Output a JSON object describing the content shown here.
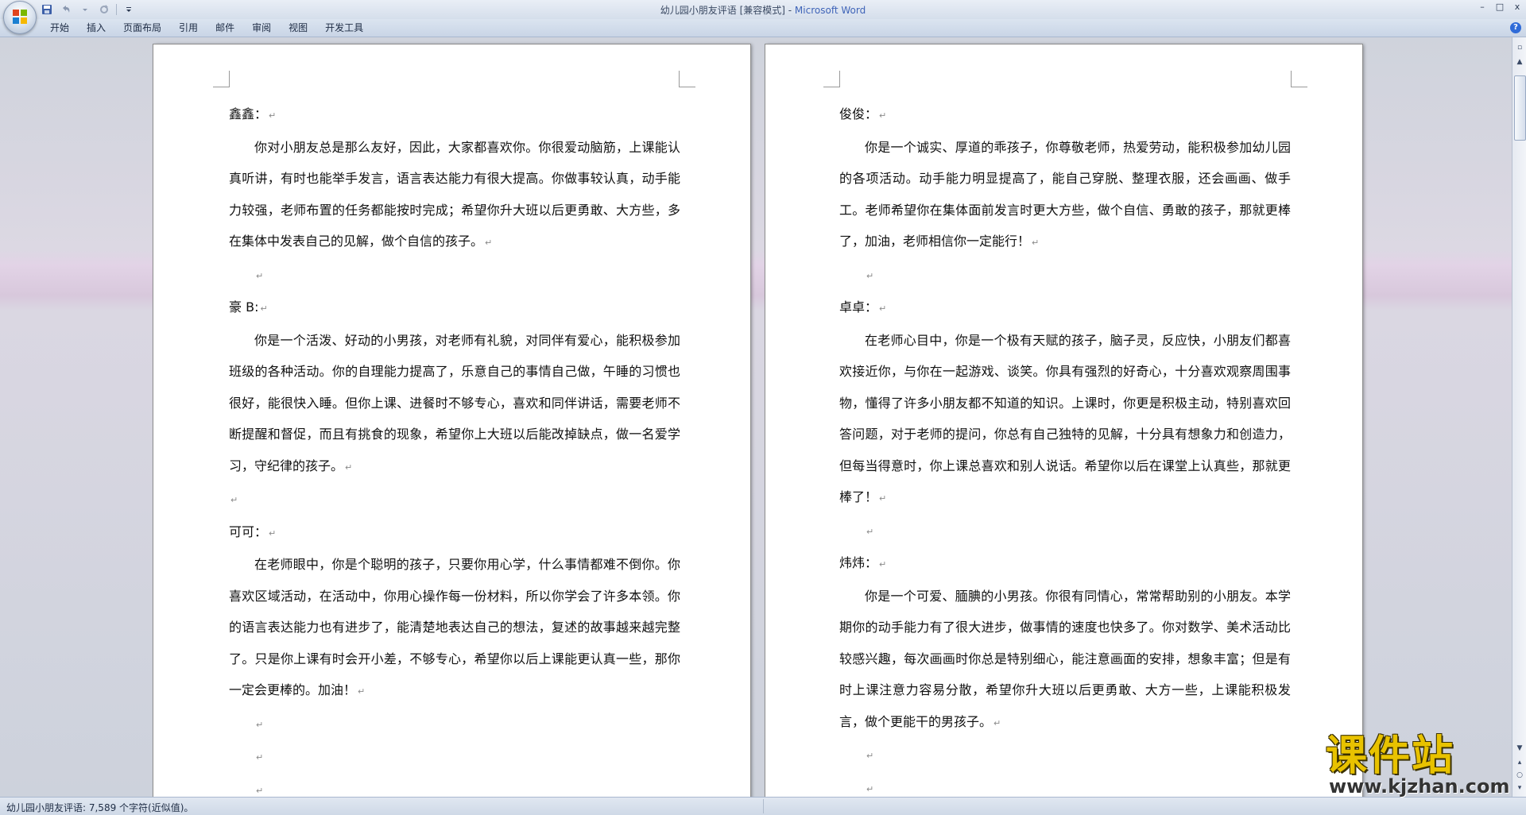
{
  "window": {
    "title_doc": "幼儿园小朋友评语 [兼容模式] - ",
    "title_app": "Microsoft Word",
    "minimize": "–",
    "maximize": "□",
    "close": "x"
  },
  "ribbon": {
    "tabs": [
      "开始",
      "插入",
      "页面布局",
      "引用",
      "邮件",
      "审阅",
      "视图",
      "开发工具"
    ],
    "help": "?"
  },
  "pages": {
    "left": [
      {
        "type": "heading",
        "text": "鑫鑫："
      },
      {
        "type": "body",
        "text": "你对小朋友总是那么友好，因此，大家都喜欢你。你很爱动脑筋，上课能认真听讲，有时也能举手发言，语言表达能力有很大提高。你做事较认真，动手能力较强，老师布置的任务都能按时完成；希望你升大班以后更勇敢、大方些，多在集体中发表自己的见解，做个自信的孩子。"
      },
      {
        "type": "empty",
        "text": ""
      },
      {
        "type": "heading",
        "text": "豪 B:"
      },
      {
        "type": "body",
        "text": "你是一个活泼、好动的小男孩，对老师有礼貌，对同伴有爱心，能积极参加班级的各种活动。你的自理能力提高了，乐意自己的事情自己做，午睡的习惯也很好，能很快入睡。但你上课、进餐时不够专心，喜欢和同伴讲话，需要老师不断提醒和督促，而且有挑食的现象，希望你上大班以后能改掉缺点，做一名爱学习，守纪律的孩子。"
      },
      {
        "type": "empty-flush",
        "text": ""
      },
      {
        "type": "heading",
        "text": "可可："
      },
      {
        "type": "body",
        "text": "在老师眼中，你是个聪明的孩子，只要你用心学，什么事情都难不倒你。你喜欢区域活动，在活动中，你用心操作每一份材料，所以你学会了许多本领。你的语言表达能力也有进步了，能清楚地表达自己的想法，复述的故事越来越完整了。只是你上课有时会开小差，不够专心，希望你以后上课能更认真一些，那你一定会更棒的。加油！"
      },
      {
        "type": "empty",
        "text": ""
      },
      {
        "type": "empty",
        "text": ""
      },
      {
        "type": "empty",
        "text": ""
      }
    ],
    "right": [
      {
        "type": "heading",
        "text": "俊俊："
      },
      {
        "type": "body",
        "text": "你是一个诚实、厚道的乖孩子，你尊敬老师，热爱劳动，能积极参加幼儿园的各项活动。动手能力明显提高了，能自己穿脱、整理衣服，还会画画、做手工。老师希望你在集体面前发言时更大方些，做个自信、勇敢的孩子，那就更棒了，加油，老师相信你一定能行！"
      },
      {
        "type": "empty",
        "text": ""
      },
      {
        "type": "heading",
        "text": "卓卓："
      },
      {
        "type": "body",
        "text": "在老师心目中，你是一个极有天赋的孩子，脑子灵，反应快，小朋友们都喜欢接近你，与你在一起游戏、谈笑。你具有强烈的好奇心，十分喜欢观察周围事物，懂得了许多小朋友都不知道的知识。上课时，你更是积极主动，特别喜欢回答问题，对于老师的提问，你总有自己独特的见解，十分具有想象力和创造力，但每当得意时，你上课总喜欢和别人说话。希望你以后在课堂上认真些，那就更棒了！"
      },
      {
        "type": "empty",
        "text": ""
      },
      {
        "type": "heading",
        "text": "炜炜："
      },
      {
        "type": "body",
        "text": "你是一个可爱、腼腆的小男孩。你很有同情心，常常帮助别的小朋友。本学期你的动手能力有了很大进步，做事情的速度也快多了。你对数学、美术活动比较感兴趣，每次画画时你总是特别细心，能注意画面的安排，想象丰富；但是有时上课注意力容易分散，希望你升大班以后更勇敢、大方一些，上课能积极发言，做个更能干的男孩子。"
      },
      {
        "type": "empty",
        "text": ""
      },
      {
        "type": "empty",
        "text": ""
      }
    ]
  },
  "paragraph_mark": "↵",
  "status": {
    "text": "幼儿园小朋友评语: 7,589 个字符(近似值)。"
  },
  "watermark": {
    "cn": "课件站",
    "url": "www.kjzhan.com"
  },
  "colors": {
    "title_app": "#3f64b8",
    "watermark": "#e8c200"
  }
}
